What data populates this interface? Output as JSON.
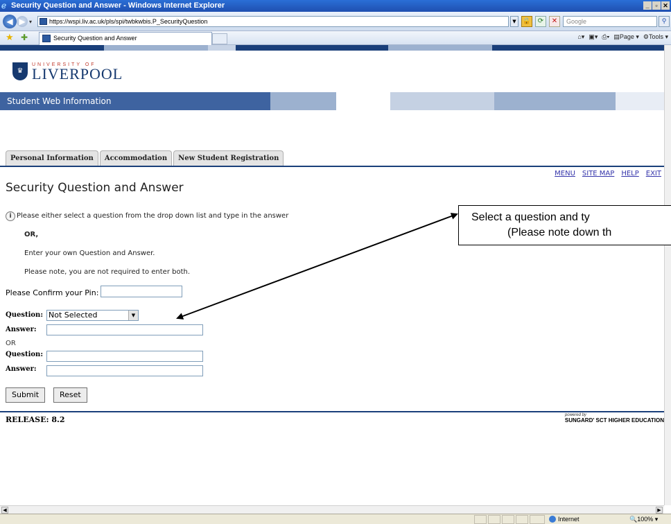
{
  "window": {
    "title": "Security Question and Answer - Windows Internet Explorer"
  },
  "browser": {
    "url": "https://wspi.liv.ac.uk/pls/spi/twbkwbis.P_SecurityQuestion",
    "search_placeholder": "Google",
    "tab_title": "Security Question and Answer",
    "cmd_home": "▾",
    "cmd_feeds": "▾",
    "cmd_print": "▾",
    "cmd_page": "Page ▾",
    "cmd_tools": "Tools ▾",
    "icons": [
      "back-icon",
      "forward-icon",
      "lock-icon",
      "refresh-icon",
      "stop-icon",
      "search-icon",
      "favorites-star-icon",
      "add-favorites-icon",
      "home-icon",
      "feeds-icon",
      "print-icon",
      "page-icon",
      "tools-icon"
    ]
  },
  "site": {
    "logo_top": "UNIVERSITY OF",
    "logo_name": "LIVERPOOL",
    "app_name": "Student Web Information",
    "brand_colors": {
      "navy": "#1a3f7a",
      "bar_blue": "#3e63a0",
      "light_blue": "#9cb1cf"
    }
  },
  "tabs": [
    {
      "label": "Personal Information"
    },
    {
      "label": "Accommodation"
    },
    {
      "label": "New Student Registration"
    }
  ],
  "toplinks": {
    "menu": "MENU",
    "sitemap": "SITE MAP",
    "help": "HELP",
    "exit": "EXIT"
  },
  "page": {
    "title": "Security Question and Answer",
    "info_line1": "Please either select a question from the drop down list and type in the answer",
    "or_bold": "OR,",
    "info_line2": "Enter your own Question and Answer.",
    "info_line3": "Please note, you are not required to enter both."
  },
  "form": {
    "pin_label": "Please Confirm your Pin:",
    "question_label": "Question:",
    "question_selected": "Not Selected",
    "answer_label": "Answer:",
    "or_label": "OR",
    "question2_label": "Question:",
    "answer2_label": "Answer:",
    "submit_label": "Submit",
    "reset_label": "Reset"
  },
  "footer": {
    "release": "RELEASE: 8.2",
    "powered_by": "powered by",
    "vendor": "SUNGARD' SCT HIGHER EDUCATION"
  },
  "callout": {
    "line1": "Select a question and ty",
    "line2": "(Please note down th"
  },
  "statusbar": {
    "zone": "Internet",
    "zoom": "100%"
  }
}
